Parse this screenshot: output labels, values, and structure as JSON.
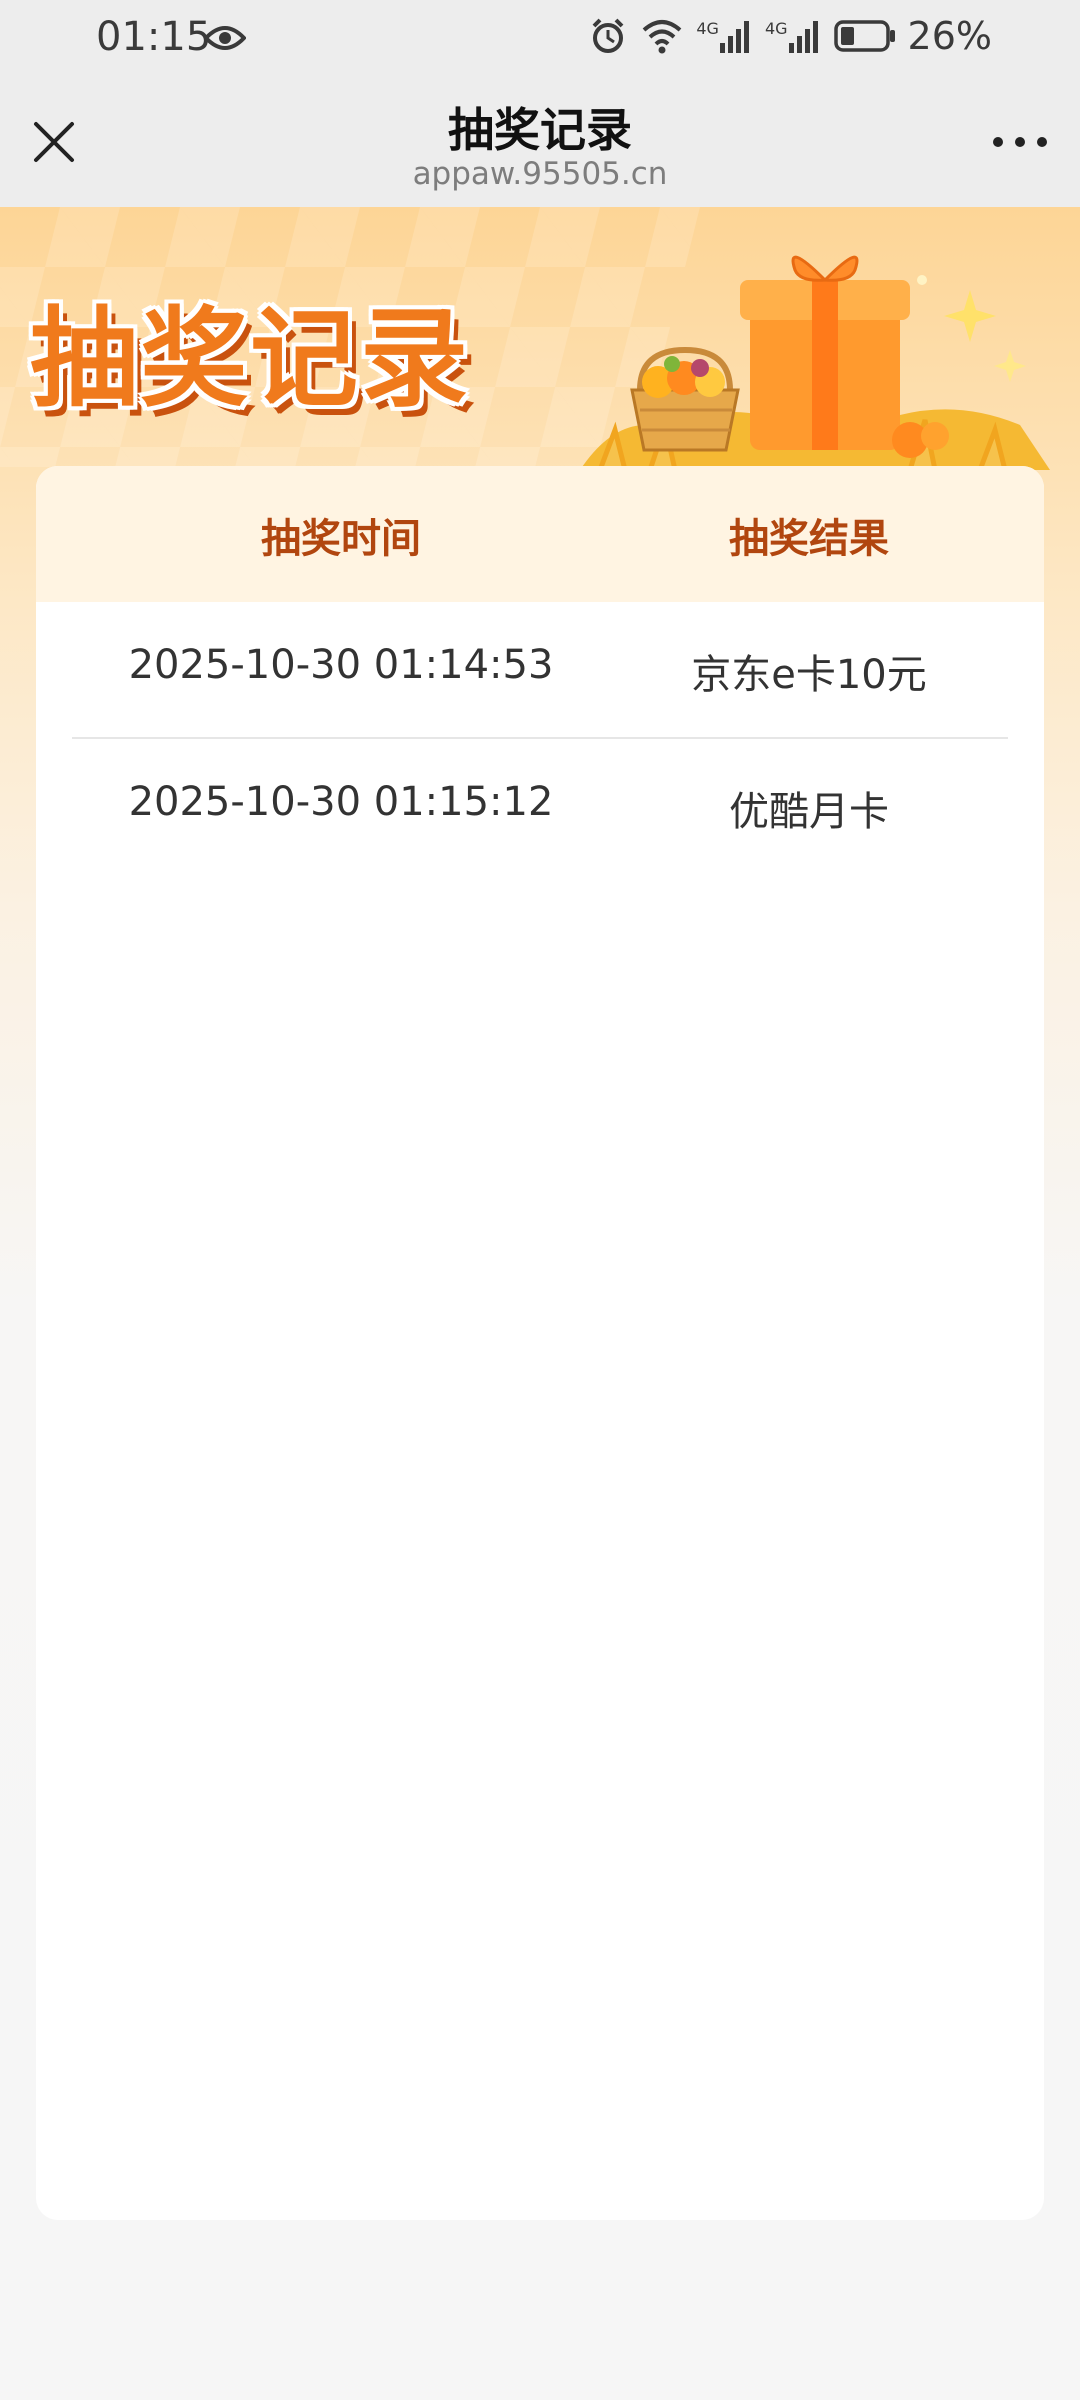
{
  "status_bar": {
    "time": "01:15",
    "battery": "26%",
    "network_a": "4G",
    "network_b": "4G"
  },
  "navbar": {
    "title": "抽奖记录",
    "subtitle": "appaw.95505.cn"
  },
  "banner": {
    "title": "抽奖记录"
  },
  "table": {
    "headers": {
      "time": "抽奖时间",
      "result": "抽奖结果"
    },
    "rows": [
      {
        "time": "2025-10-30 01:14:53",
        "result": "京东e卡10元"
      },
      {
        "time": "2025-10-30 01:15:12",
        "result": "优酷月卡"
      }
    ]
  },
  "colors": {
    "accent": "#f07a1c",
    "header_text": "#b1460f",
    "header_bg": "#fff4e2"
  }
}
